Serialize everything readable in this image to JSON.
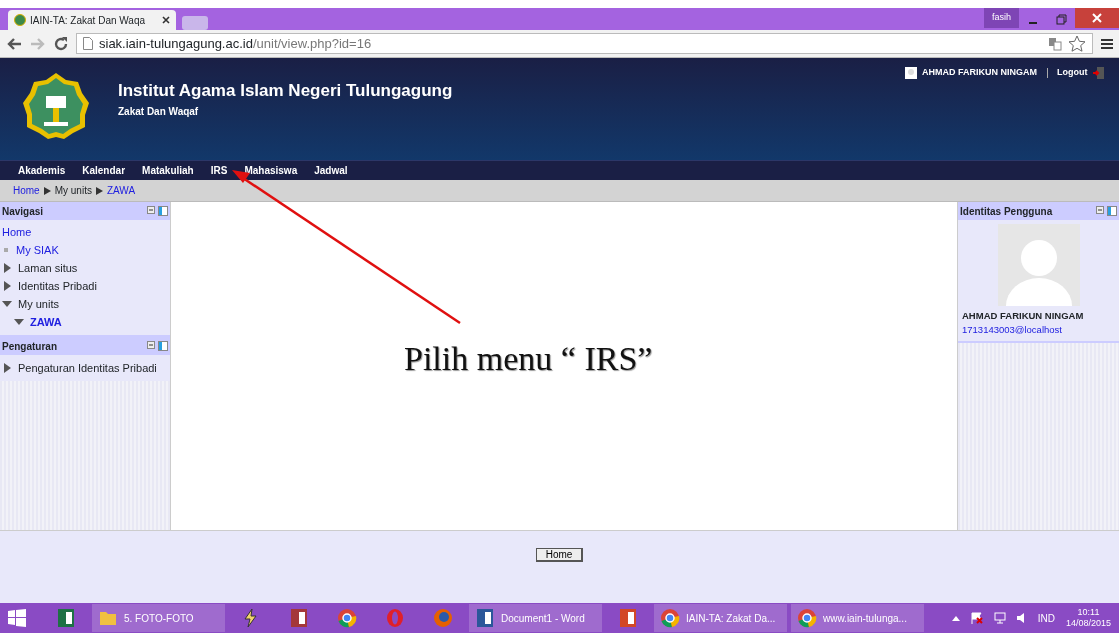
{
  "browser": {
    "tab_title": "IAIN-TA: Zakat Dan Waqa",
    "profile": "fasih",
    "url_host": "siak.iain-tulungagung.ac.id",
    "url_path": "/unit/view.php?id=16"
  },
  "header": {
    "title": "Institut Agama Islam Negeri Tulungagung",
    "subtitle": "Zakat Dan Waqaf",
    "user": "AHMAD FARIKUN NINGAM",
    "logout": "Logout"
  },
  "menu": [
    "Akademis",
    "Kalendar",
    "Matakuliah",
    "IRS",
    "Mahasiswa",
    "Jadwal"
  ],
  "breadcrumb": [
    {
      "label": "Home",
      "kind": "link"
    },
    {
      "label": "My units",
      "kind": "text"
    },
    {
      "label": "ZAWA",
      "kind": "link"
    }
  ],
  "navigasi": {
    "title": "Navigasi",
    "items": [
      {
        "label": "Home",
        "kind": "link"
      },
      {
        "label": "My SIAK",
        "kind": "leaf"
      },
      {
        "label": "Laman situs",
        "kind": "branch",
        "expanded": false
      },
      {
        "label": "Identitas Pribadi",
        "kind": "branch",
        "expanded": false
      },
      {
        "label": "My units",
        "kind": "branch",
        "expanded": true,
        "children": [
          {
            "label": "ZAWA",
            "kind": "current",
            "expanded": true
          }
        ]
      }
    ]
  },
  "pengaturan": {
    "title": "Pengaturan",
    "items": [
      {
        "label": "Pengaturan Identitas Pribadi",
        "expanded": false
      }
    ]
  },
  "identitas": {
    "title": "Identitas Pengguna",
    "name": "AHMAD FARIKUN NINGAM",
    "email": "1713143003@localhost"
  },
  "annotation": "Pilih menu “ IRS”",
  "footer_button": "Home",
  "taskbar": [
    {
      "kind": "excel"
    },
    {
      "label": "5. FOTO-FOTO",
      "kind": "folder"
    },
    {
      "kind": "winamp"
    },
    {
      "kind": "access"
    },
    {
      "kind": "chrome"
    },
    {
      "kind": "opera"
    },
    {
      "kind": "firefox"
    },
    {
      "label": "Document1 - Word",
      "kind": "word"
    },
    {
      "kind": "ppt"
    },
    {
      "label": "IAIN-TA: Zakat Da...",
      "kind": "chrome"
    },
    {
      "label": "www.iain-tulunga...",
      "kind": "chrome"
    }
  ],
  "tray": {
    "lang": "IND",
    "time": "10:11",
    "date": "14/08/2015"
  }
}
